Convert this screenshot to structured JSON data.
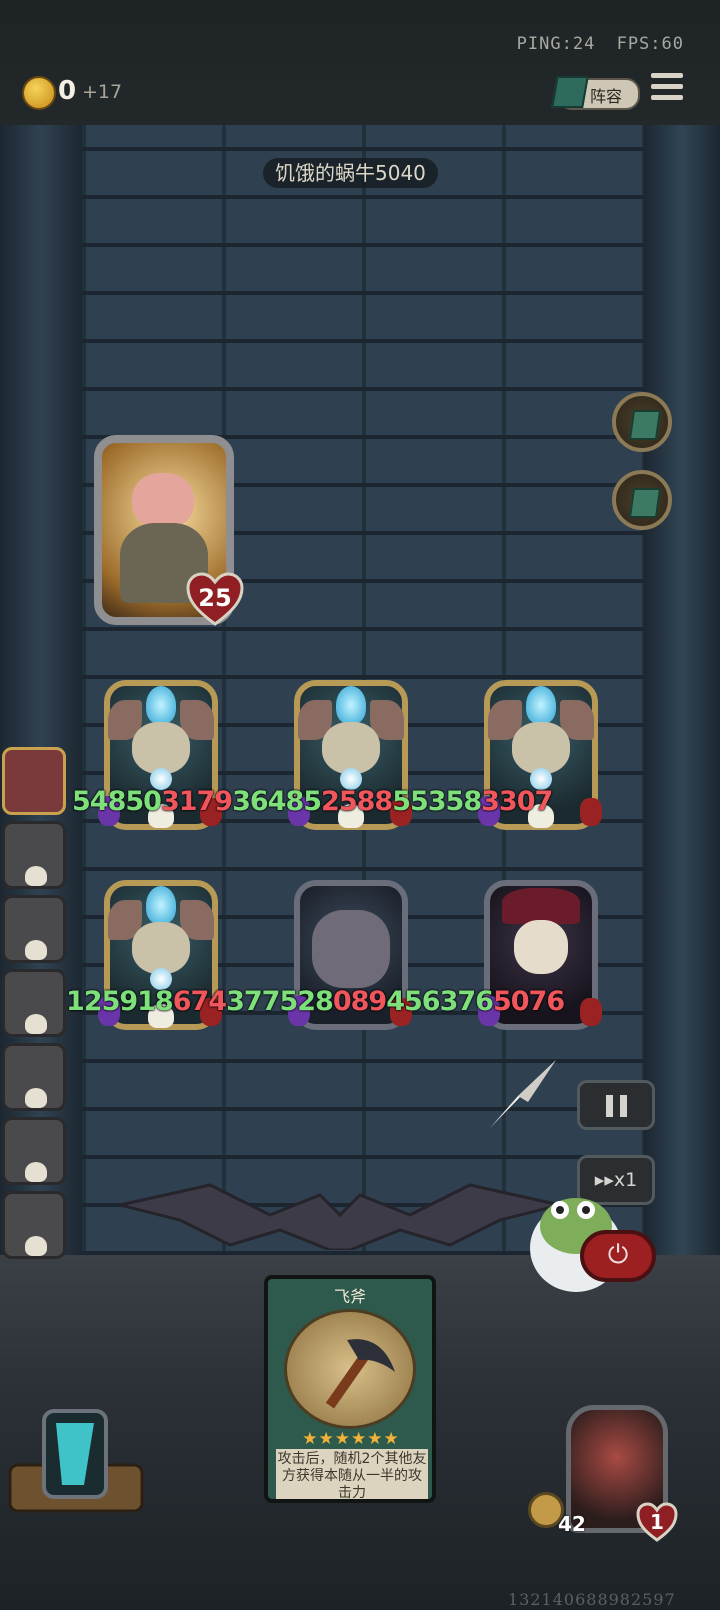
{
  "header": {
    "ping_label": "PING:24",
    "fps_label": "FPS:60",
    "coins": "0",
    "coin_bonus": "+17",
    "lineup_label": "阵容",
    "icons": [
      "coin-icon",
      "book-icon",
      "menu-icon"
    ]
  },
  "boss": {
    "name": "饥饿的蜗牛5040",
    "health": "25",
    "icons": [
      "pig-portrait",
      "heart-icon"
    ]
  },
  "board": {
    "row1_numbers": [
      {
        "text": "54850",
        "color": "green"
      },
      {
        "text": "3179",
        "color": "red"
      },
      {
        "text": "36485",
        "color": "green"
      },
      {
        "text": "2588",
        "color": "red"
      },
      {
        "text": "55358",
        "color": "green"
      },
      {
        "text": "3307",
        "color": "red"
      }
    ],
    "row2_numbers": [
      {
        "text": "125918",
        "color": "green"
      },
      {
        "text": "674",
        "color": "red"
      },
      {
        "text": "377528",
        "color": "green"
      },
      {
        "text": "089",
        "color": "red"
      },
      {
        "text": "456376",
        "color": "green"
      },
      {
        "text": "5076",
        "color": "red"
      }
    ]
  },
  "controls": {
    "speed_label": "▸▸x1",
    "power_symbol": "⏻"
  },
  "card": {
    "title": "飞斧",
    "stars": "★★★★★★",
    "text": "攻击后，随机2个其他友方获得本随从一半的攻击力"
  },
  "hero": {
    "attack": "42",
    "health": "1"
  },
  "footer": {
    "uid": "132140688982597"
  },
  "colors": {
    "green_number": "#7ee07a",
    "red_number": "#f0565c",
    "gold_frame": "#b89a57",
    "wall": "#2f4050"
  }
}
